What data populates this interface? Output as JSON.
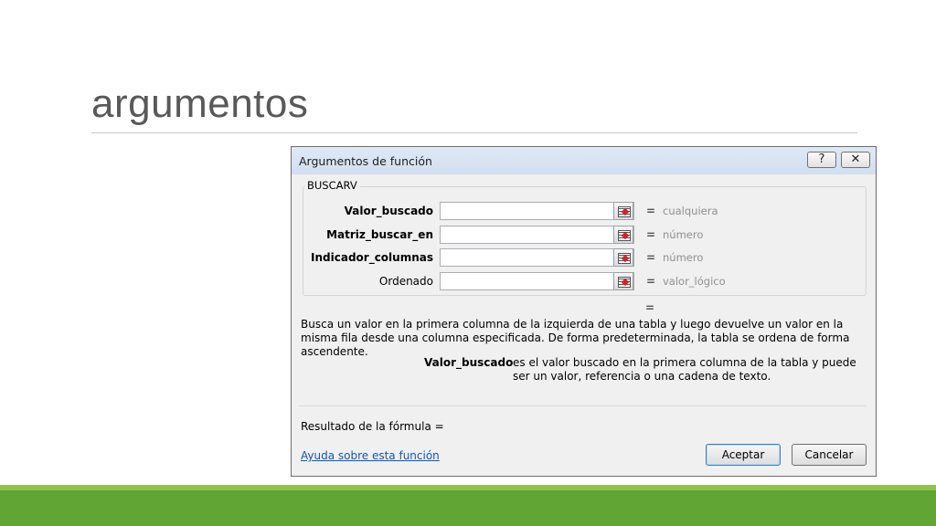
{
  "slide": {
    "title": "argumentos"
  },
  "dialog": {
    "title": "Argumentos de función",
    "help_button": "?",
    "close_button": "✕",
    "function_name": "BUSCARV",
    "arguments": [
      {
        "label": "Valor_buscado",
        "value": "",
        "type": "cualquiera"
      },
      {
        "label": "Matriz_buscar_en",
        "value": "",
        "type": "número"
      },
      {
        "label": "Indicador_columnas",
        "value": "",
        "type": "número"
      },
      {
        "label": "Ordenado",
        "value": "",
        "type": "valor_lógico"
      }
    ],
    "equals": "=",
    "result_equals": "=",
    "description": "Busca un valor en la primera columna de la izquierda de una tabla y luego devuelve un valor en la misma fila desde una columna especificada. De forma predeterminada, la tabla se ordena de forma ascendente.",
    "param_name": "Valor_buscado",
    "param_description": "es el valor buscado en la primera columna de la tabla y puede ser un valor, referencia o una cadena de texto.",
    "formula_result": "Resultado de la fórmula =",
    "help_link": "Ayuda sobre esta función",
    "ok_label": "Aceptar",
    "cancel_label": "Cancelar"
  }
}
